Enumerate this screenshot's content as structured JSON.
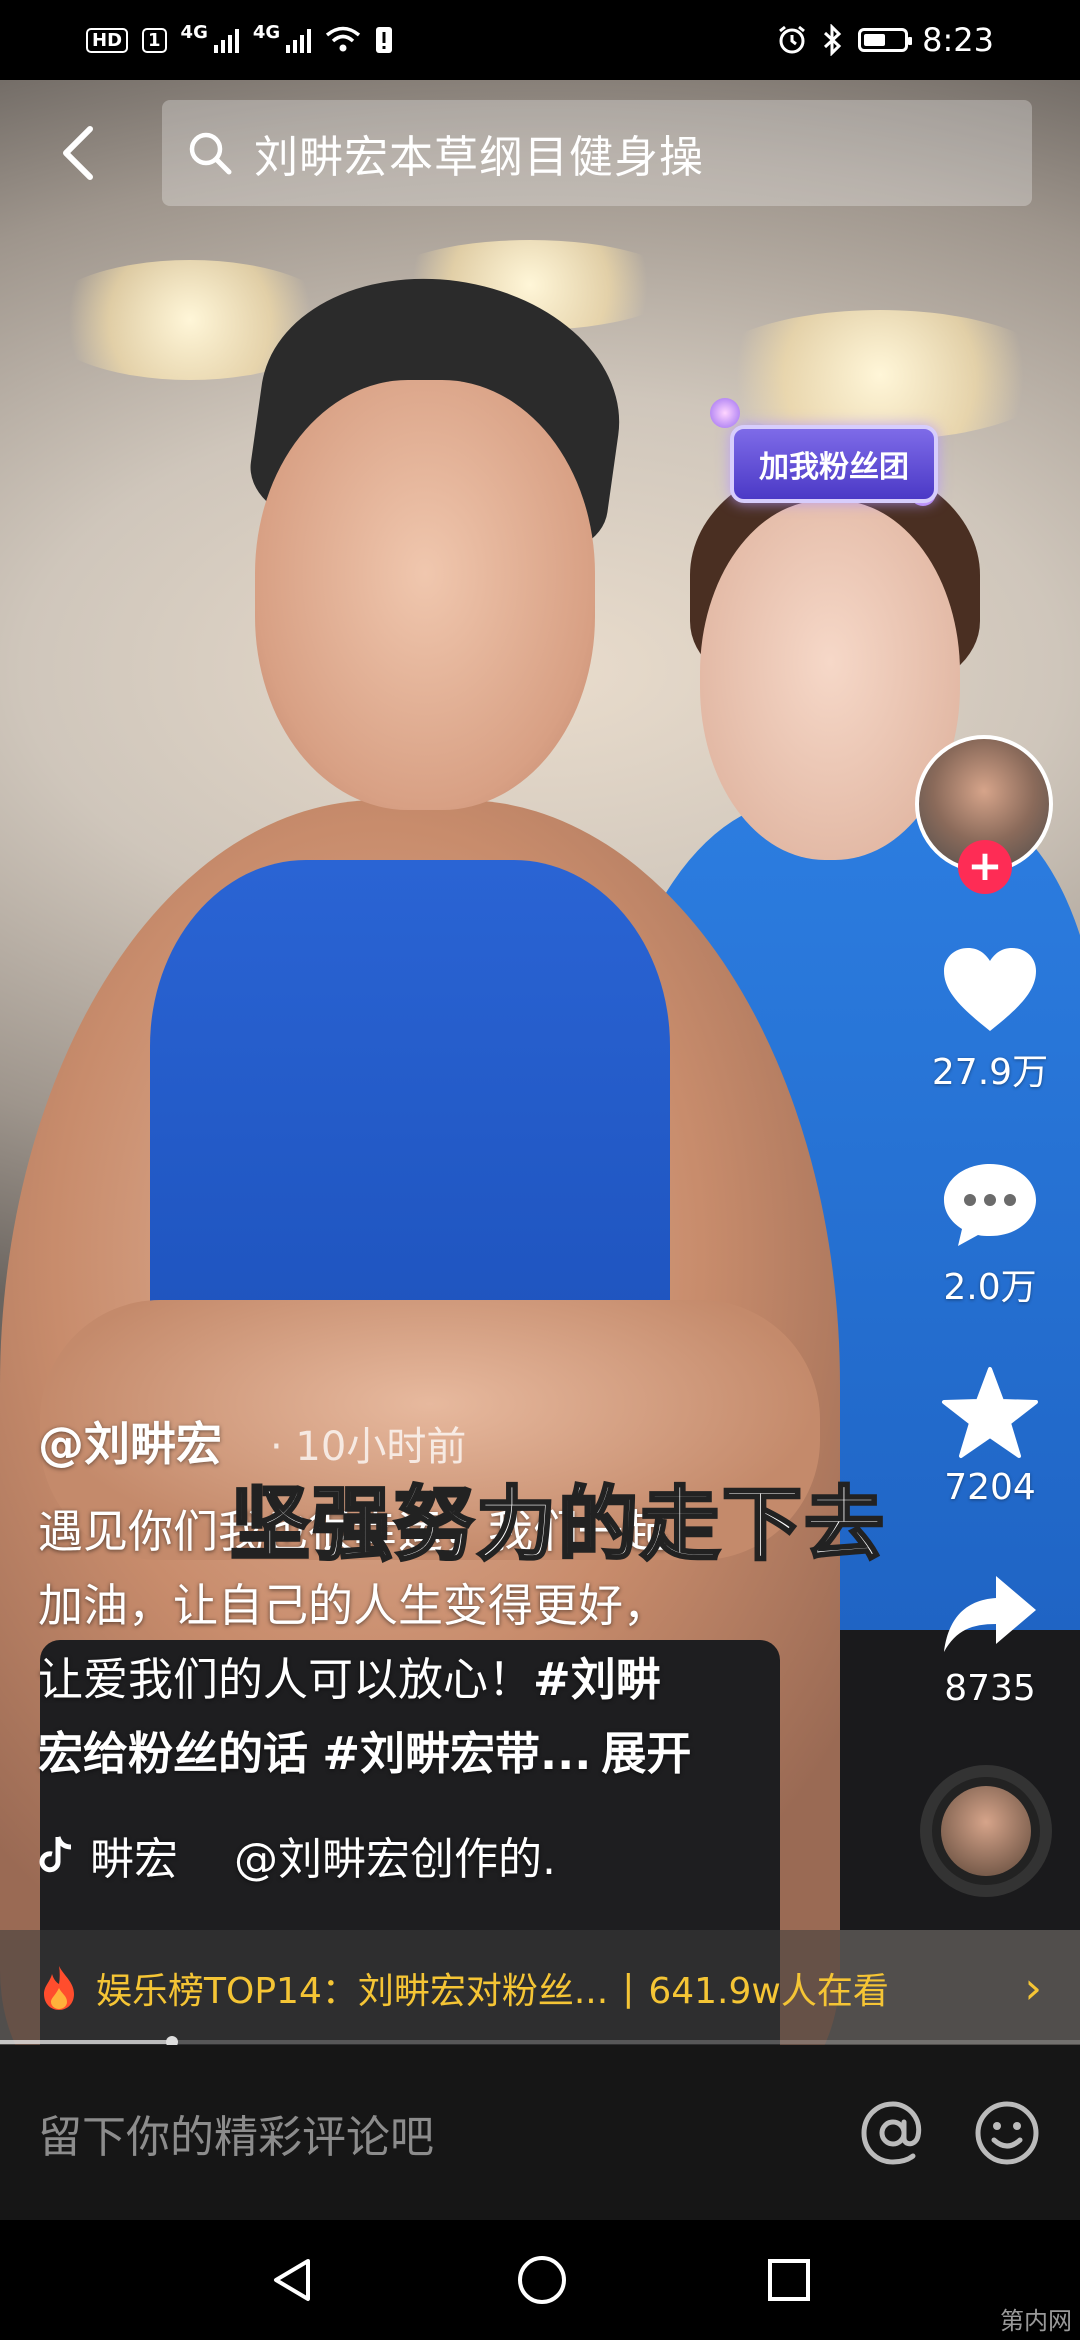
{
  "status_bar": {
    "hd_badge": "HD",
    "sim_badge": "1",
    "net1": "4G",
    "net2": "4G",
    "time": "8:23"
  },
  "search": {
    "query": "刘畊宏本草纲目健身操"
  },
  "sticker": {
    "fan_badge": "加我粉丝团"
  },
  "rail": {
    "likes": "27.9万",
    "comments": "2.0万",
    "favorites": "7204",
    "shares": "8735"
  },
  "post": {
    "author": "@刘畊宏",
    "time_ago": "· 10小时前",
    "overlay_title": "坚强努力的走下去",
    "desc_line1": "遇见你们我也很幸运，我们一起",
    "desc_line2": "加油，让自己的人生变得更好，",
    "desc_line3": "让爱我们的人可以放心！",
    "tag1": "#刘畊",
    "tag1b": "宏给粉丝的话",
    "tag2": "#刘畊宏带...",
    "expand": "展开",
    "music_name": "畊宏",
    "music_credit": "@刘畊宏创作的."
  },
  "hot_banner": {
    "label": "娱乐榜TOP14：刘畊宏对粉丝...",
    "sep": "|",
    "viewers": "641.9w人在看"
  },
  "comment_bar": {
    "placeholder": "留下你的精彩评论吧"
  },
  "watermark": "第内网",
  "colors": {
    "accent_red": "#fe2c55",
    "banner_yellow": "#f5c535"
  }
}
